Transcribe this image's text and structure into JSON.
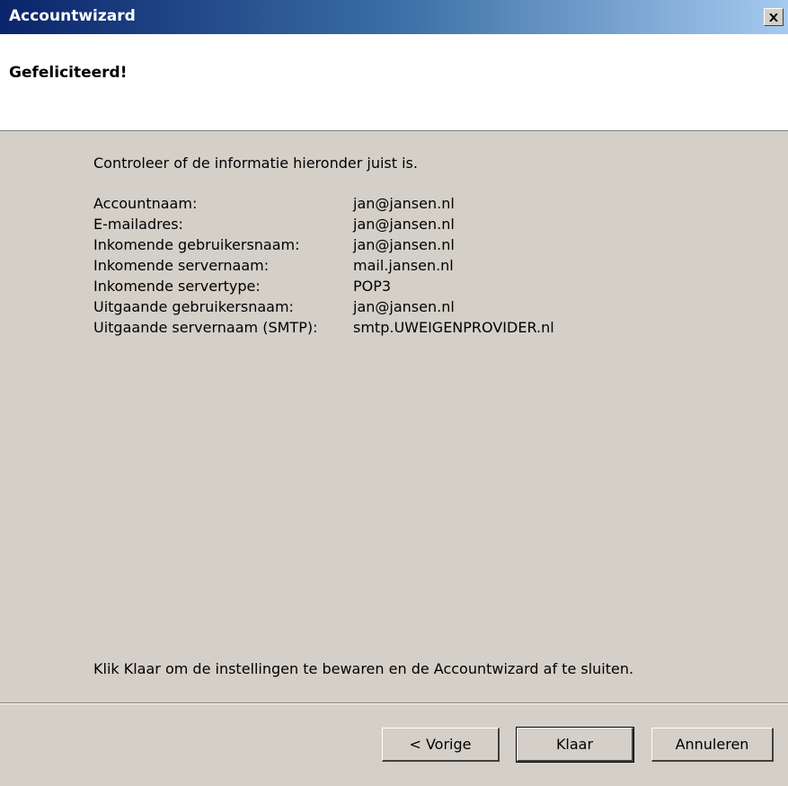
{
  "window": {
    "title": "Accountwizard",
    "close_icon": "close-icon"
  },
  "header": {
    "title": "Gefeliciteerd!"
  },
  "main": {
    "intro": "Controleer of de informatie hieronder juist is.",
    "rows": [
      {
        "label": "Accountnaam:",
        "value": "jan@jansen.nl"
      },
      {
        "label": "E-mailadres:",
        "value": "jan@jansen.nl"
      },
      {
        "label": "Inkomende gebruikersnaam:",
        "value": "jan@jansen.nl"
      },
      {
        "label": "Inkomende servernaam:",
        "value": "mail.jansen.nl"
      },
      {
        "label": "Inkomende servertype:",
        "value": "POP3"
      },
      {
        "label": "Uitgaande gebruikersnaam:",
        "value": "jan@jansen.nl"
      },
      {
        "label": "Uitgaande servernaam (SMTP):",
        "value": "smtp.UWEIGENPROVIDER.nl"
      }
    ],
    "footer": "Klik Klaar om de instellingen te bewaren en de Accountwizard af te sluiten."
  },
  "buttons": {
    "back_label": "< Vorige",
    "finish_label": "Klaar",
    "cancel_label": "Annuleren"
  },
  "colors": {
    "titlebar_start": "#0a246a",
    "titlebar_end": "#a6caf0",
    "dialog_bg": "#d4d0c8",
    "header_bg": "#ffffff"
  }
}
